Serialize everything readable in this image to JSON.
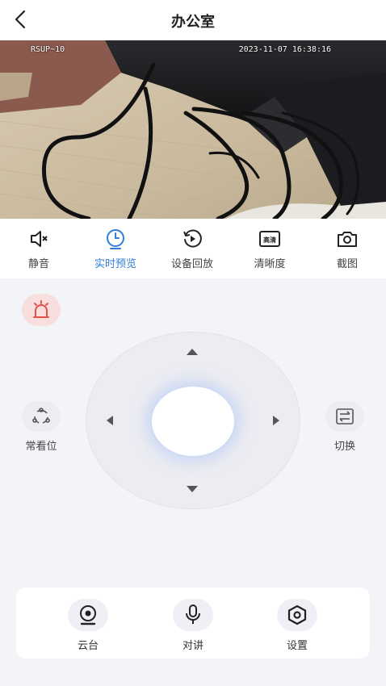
{
  "header": {
    "title": "办公室"
  },
  "video": {
    "camera_label": "RSUP~10",
    "timestamp": "2023-11-07 16:38:16"
  },
  "toolbar": {
    "items": [
      {
        "label": "静音",
        "icon": "mute-icon"
      },
      {
        "label": "实时预览",
        "icon": "clock-icon",
        "active": true
      },
      {
        "label": "设备回放",
        "icon": "replay-icon"
      },
      {
        "label": "清晰度",
        "icon": "hd-icon",
        "badge": "高清"
      },
      {
        "label": "截图",
        "icon": "camera-icon"
      }
    ]
  },
  "controls": {
    "alarm_icon": "alarm-icon",
    "preset_label": "常看位",
    "switch_label": "切换"
  },
  "bottom": {
    "items": [
      {
        "label": "云台",
        "icon": "webcam-icon"
      },
      {
        "label": "对讲",
        "icon": "microphone-icon"
      },
      {
        "label": "设置",
        "icon": "hex-settings-icon"
      }
    ]
  },
  "colors": {
    "accent": "#2f7fd6",
    "alarm": "#e0524a",
    "background": "#f3f4f8"
  }
}
